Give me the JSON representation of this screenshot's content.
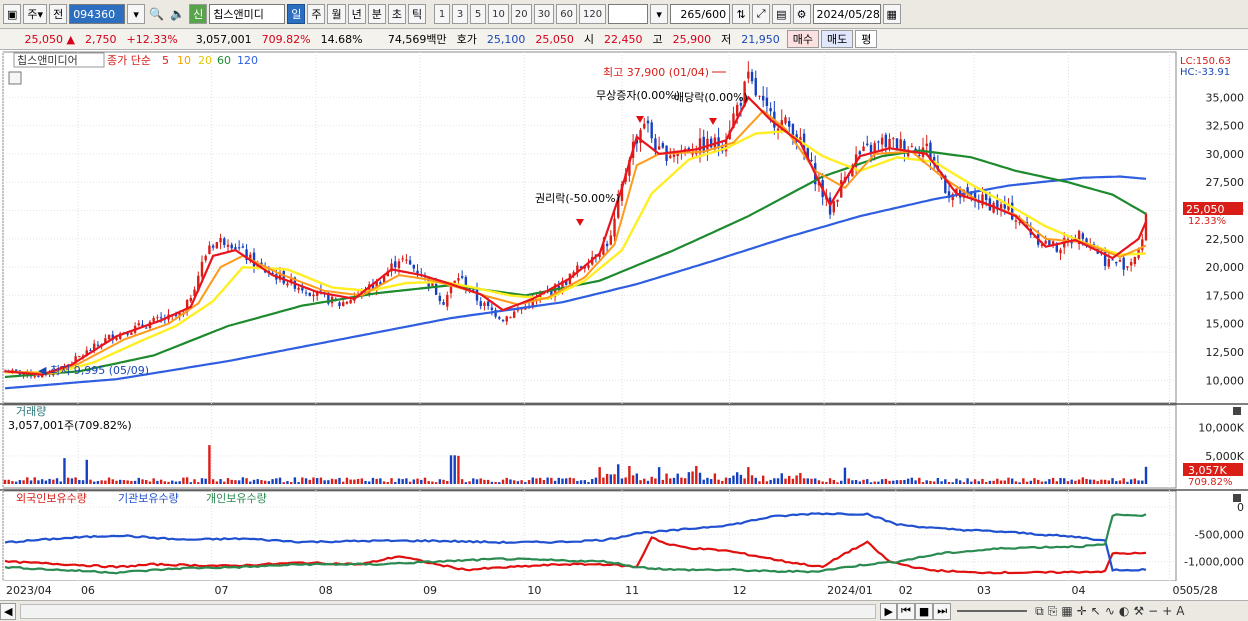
{
  "toolbar": {
    "market": "주",
    "prev": "전",
    "code": "094360",
    "type_badge": "신",
    "name": "칩스앤미디",
    "periods": [
      "일",
      "주",
      "월",
      "년",
      "분",
      "초",
      "틱"
    ],
    "active_period": "일",
    "counts": [
      "1",
      "3",
      "5",
      "10",
      "20",
      "30",
      "60",
      "120"
    ],
    "bars": "265",
    "bars_total": "/600",
    "date": "2024/05/28"
  },
  "info": {
    "price": "25,050",
    "arrow": "▲",
    "change": "2,750",
    "change_pct": "+12.33%",
    "volume": "3,057,001",
    "vol_ratio": "709.82%",
    "turnover": "14.68%",
    "amount": "74,569백만",
    "hoga_label": "호가",
    "hoga_ask": "25,100",
    "hoga_bid": "25,050",
    "open_label": "시",
    "open": "22,450",
    "high_label": "고",
    "high": "25,900",
    "low_label": "저",
    "low": "21,950",
    "buy": "매수",
    "sell": "매도",
    "avg": "평"
  },
  "colors": {
    "up": "#d91e18",
    "down": "#1540c0",
    "ma5": "#e8141e",
    "ma10": "#ff9a1a",
    "ma20": "#ffee22",
    "ma60": "#1e8a2e",
    "ma120": "#2f5ee0"
  },
  "chart_data": [
    {
      "type": "candlestick",
      "title": "칩스앤미디어",
      "subtitle": "종가 단순",
      "ma_periods": [
        5,
        10,
        20,
        60,
        120
      ],
      "lc_label": "LC:150.63",
      "hc_label": "HC:-33.91",
      "ylim": [
        8000,
        39000
      ],
      "yticks": [
        10000,
        12500,
        15000,
        17500,
        20000,
        22500,
        25000,
        27500,
        30000,
        32500,
        35000
      ],
      "ytick_labels": [
        "10,000",
        "12,500",
        "15,000",
        "17,500",
        "20,000",
        "22,500",
        "25,000",
        "27,500",
        "30,000",
        "32,500",
        "35,000"
      ],
      "last_price": "25,050",
      "last_pct": "12.33%",
      "annotations": [
        "최고 37,900 (01/04)",
        "최저 9,995 (05/09)",
        "무상증자(0.00%)",
        "배당락(0.00%)",
        "권리락(-50.00%)"
      ],
      "anchors": [
        [
          0,
          10800
        ],
        [
          10,
          10400
        ],
        [
          16,
          11200
        ],
        [
          28,
          13800
        ],
        [
          40,
          15200
        ],
        [
          48,
          15800
        ],
        [
          55,
          22000
        ],
        [
          60,
          22500
        ],
        [
          68,
          20000
        ],
        [
          80,
          18200
        ],
        [
          90,
          16700
        ],
        [
          100,
          18500
        ],
        [
          106,
          20800
        ],
        [
          112,
          19500
        ],
        [
          118,
          17000
        ],
        [
          122,
          19200
        ],
        [
          128,
          16800
        ],
        [
          134,
          15500
        ],
        [
          140,
          16500
        ],
        [
          150,
          18500
        ],
        [
          158,
          21000
        ],
        [
          163,
          22500
        ],
        [
          168,
          30000
        ],
        [
          172,
          33000
        ],
        [
          176,
          30000
        ],
        [
          185,
          30500
        ],
        [
          193,
          31000
        ],
        [
          200,
          36500
        ],
        [
          205,
          33500
        ],
        [
          212,
          32200
        ],
        [
          216,
          29500
        ],
        [
          222,
          25000
        ],
        [
          228,
          29500
        ],
        [
          236,
          31000
        ],
        [
          248,
          30500
        ],
        [
          254,
          26500
        ],
        [
          262,
          26000
        ],
        [
          270,
          25000
        ],
        [
          278,
          22500
        ],
        [
          283,
          21700
        ],
        [
          290,
          23000
        ],
        [
          296,
          20600
        ],
        [
          302,
          20200
        ],
        [
          306,
          22000
        ],
        [
          307,
          25050
        ]
      ],
      "ma5_anchors": [
        [
          0,
          10800
        ],
        [
          10,
          10500
        ],
        [
          18,
          11400
        ],
        [
          30,
          13900
        ],
        [
          42,
          15300
        ],
        [
          50,
          16500
        ],
        [
          56,
          21000
        ],
        [
          62,
          21500
        ],
        [
          72,
          19300
        ],
        [
          84,
          17800
        ],
        [
          94,
          17200
        ],
        [
          104,
          19800
        ],
        [
          112,
          19300
        ],
        [
          120,
          18500
        ],
        [
          128,
          17600
        ],
        [
          134,
          16200
        ],
        [
          142,
          17200
        ],
        [
          152,
          19000
        ],
        [
          160,
          21200
        ],
        [
          166,
          27000
        ],
        [
          170,
          31500
        ],
        [
          176,
          30000
        ],
        [
          186,
          30400
        ],
        [
          194,
          31200
        ],
        [
          200,
          35000
        ],
        [
          206,
          33000
        ],
        [
          214,
          31000
        ],
        [
          222,
          25500
        ],
        [
          230,
          29800
        ],
        [
          238,
          30500
        ],
        [
          248,
          30000
        ],
        [
          256,
          26500
        ],
        [
          264,
          25600
        ],
        [
          272,
          24500
        ],
        [
          280,
          21800
        ],
        [
          288,
          22400
        ],
        [
          298,
          20800
        ],
        [
          305,
          22500
        ],
        [
          307,
          24000
        ]
      ],
      "ma10_anchors": [
        [
          0,
          10800
        ],
        [
          12,
          10600
        ],
        [
          20,
          11500
        ],
        [
          32,
          13600
        ],
        [
          44,
          15000
        ],
        [
          52,
          16800
        ],
        [
          58,
          20000
        ],
        [
          64,
          21000
        ],
        [
          74,
          19400
        ],
        [
          86,
          17900
        ],
        [
          96,
          17500
        ],
        [
          106,
          19300
        ],
        [
          114,
          18900
        ],
        [
          122,
          18200
        ],
        [
          130,
          17400
        ],
        [
          138,
          16700
        ],
        [
          146,
          17300
        ],
        [
          156,
          19100
        ],
        [
          164,
          22000
        ],
        [
          170,
          29000
        ],
        [
          176,
          30000
        ],
        [
          188,
          30200
        ],
        [
          196,
          31000
        ],
        [
          204,
          33800
        ],
        [
          210,
          32200
        ],
        [
          218,
          28500
        ],
        [
          226,
          27000
        ],
        [
          234,
          30000
        ],
        [
          244,
          30200
        ],
        [
          252,
          28000
        ],
        [
          262,
          25800
        ],
        [
          272,
          24600
        ],
        [
          280,
          22500
        ],
        [
          290,
          22200
        ],
        [
          300,
          20900
        ],
        [
          307,
          21900
        ]
      ],
      "ma20_anchors": [
        [
          0,
          10700
        ],
        [
          14,
          10700
        ],
        [
          24,
          11600
        ],
        [
          36,
          13400
        ],
        [
          46,
          14800
        ],
        [
          56,
          17000
        ],
        [
          64,
          20000
        ],
        [
          76,
          19800
        ],
        [
          88,
          18200
        ],
        [
          98,
          17900
        ],
        [
          108,
          18600
        ],
        [
          118,
          18700
        ],
        [
          126,
          18200
        ],
        [
          136,
          17500
        ],
        [
          146,
          17200
        ],
        [
          156,
          18800
        ],
        [
          166,
          21500
        ],
        [
          174,
          26500
        ],
        [
          184,
          29500
        ],
        [
          194,
          30500
        ],
        [
          202,
          31800
        ],
        [
          210,
          32000
        ],
        [
          220,
          29800
        ],
        [
          230,
          28500
        ],
        [
          240,
          29700
        ],
        [
          250,
          29300
        ],
        [
          260,
          27300
        ],
        [
          270,
          25500
        ],
        [
          280,
          23600
        ],
        [
          290,
          22200
        ],
        [
          300,
          21100
        ],
        [
          307,
          21200
        ]
      ],
      "ma60_anchors": [
        [
          0,
          10300
        ],
        [
          20,
          10800
        ],
        [
          40,
          12200
        ],
        [
          60,
          14800
        ],
        [
          80,
          16600
        ],
        [
          100,
          17700
        ],
        [
          120,
          18400
        ],
        [
          140,
          17500
        ],
        [
          160,
          18800
        ],
        [
          180,
          21500
        ],
        [
          200,
          24500
        ],
        [
          220,
          28000
        ],
        [
          236,
          29800
        ],
        [
          246,
          30300
        ],
        [
          260,
          29700
        ],
        [
          272,
          28500
        ],
        [
          286,
          27500
        ],
        [
          298,
          26400
        ],
        [
          307,
          24700
        ]
      ],
      "ma120_anchors": [
        [
          0,
          9300
        ],
        [
          30,
          10100
        ],
        [
          60,
          11700
        ],
        [
          90,
          13600
        ],
        [
          120,
          15500
        ],
        [
          150,
          16900
        ],
        [
          170,
          18500
        ],
        [
          190,
          20500
        ],
        [
          210,
          22600
        ],
        [
          230,
          24500
        ],
        [
          250,
          26000
        ],
        [
          270,
          27200
        ],
        [
          290,
          27900
        ],
        [
          300,
          28000
        ],
        [
          307,
          27800
        ]
      ]
    },
    {
      "type": "bar",
      "title": "거래량",
      "label": "3,057,001주(709.82%)",
      "yticks": [
        "5,000K",
        "10,000K"
      ],
      "last_label": "3,057K",
      "last_pct": "709.82%"
    },
    {
      "type": "line",
      "legend": [
        "외국인보유수량",
        "기관보유수량",
        "개인보유수량"
      ],
      "yticks": [
        "0",
        "-500,000",
        "-1,000,000"
      ],
      "series": [
        {
          "name": "외국인보유수량",
          "color": "#e01010",
          "anchors": [
            [
              0,
              -1000000
            ],
            [
              20,
              -1060000
            ],
            [
              30,
              -1100000
            ],
            [
              40,
              -1050000
            ],
            [
              60,
              -1080000
            ],
            [
              80,
              -1020000
            ],
            [
              96,
              -1050000
            ],
            [
              106,
              -900000
            ],
            [
              116,
              -1050000
            ],
            [
              124,
              -1150000
            ],
            [
              136,
              -1100000
            ],
            [
              150,
              -1050000
            ],
            [
              162,
              -1050000
            ],
            [
              170,
              -1100000
            ],
            [
              174,
              -550000
            ],
            [
              178,
              -680000
            ],
            [
              184,
              -750000
            ],
            [
              194,
              -800000
            ],
            [
              204,
              -920000
            ],
            [
              210,
              -1000000
            ],
            [
              220,
              -1100000
            ],
            [
              226,
              -850000
            ],
            [
              232,
              -650000
            ],
            [
              238,
              -1000000
            ],
            [
              248,
              -1150000
            ],
            [
              260,
              -1200000
            ],
            [
              280,
              -1200000
            ],
            [
              296,
              -1180000
            ],
            [
              298,
              -850000
            ],
            [
              306,
              -850000
            ]
          ]
        },
        {
          "name": "기관보유수량",
          "color": "#2050d0",
          "anchors": [
            [
              0,
              -650000
            ],
            [
              14,
              -580000
            ],
            [
              30,
              -520000
            ],
            [
              48,
              -600000
            ],
            [
              64,
              -580000
            ],
            [
              80,
              -640000
            ],
            [
              100,
              -620000
            ],
            [
              116,
              -620000
            ],
            [
              134,
              -650000
            ],
            [
              150,
              -640000
            ],
            [
              162,
              -600000
            ],
            [
              170,
              -480000
            ],
            [
              180,
              -430000
            ],
            [
              196,
              -320000
            ],
            [
              206,
              -180000
            ],
            [
              218,
              -120000
            ],
            [
              232,
              -130000
            ],
            [
              240,
              -320000
            ],
            [
              252,
              -400000
            ],
            [
              270,
              -460000
            ],
            [
              290,
              -560000
            ],
            [
              296,
              -620000
            ],
            [
              298,
              -1150000
            ],
            [
              306,
              -1150000
            ]
          ]
        },
        {
          "name": "개인보유수량",
          "color": "#2a8a50",
          "anchors": [
            [
              0,
              -1100000
            ],
            [
              14,
              -1150000
            ],
            [
              30,
              -1200000
            ],
            [
              48,
              -1120000
            ],
            [
              64,
              -1100000
            ],
            [
              80,
              -1050000
            ],
            [
              100,
              -1050000
            ],
            [
              116,
              -1000000
            ],
            [
              134,
              -950000
            ],
            [
              150,
              -980000
            ],
            [
              162,
              -1000000
            ],
            [
              170,
              -1100000
            ],
            [
              180,
              -1150000
            ],
            [
              196,
              -1150000
            ],
            [
              206,
              -1180000
            ],
            [
              218,
              -1180000
            ],
            [
              232,
              -1050000
            ],
            [
              240,
              -1000000
            ],
            [
              252,
              -850000
            ],
            [
              270,
              -750000
            ],
            [
              290,
              -720000
            ],
            [
              296,
              -690000
            ],
            [
              298,
              -150000
            ],
            [
              306,
              -150000
            ]
          ]
        }
      ]
    }
  ],
  "xaxis": {
    "labels": [
      "2023/04",
      "06",
      "07",
      "08",
      "09",
      "10",
      "11",
      "12",
      "2024/01",
      "02",
      "03",
      "04",
      "05",
      "05/28"
    ]
  }
}
